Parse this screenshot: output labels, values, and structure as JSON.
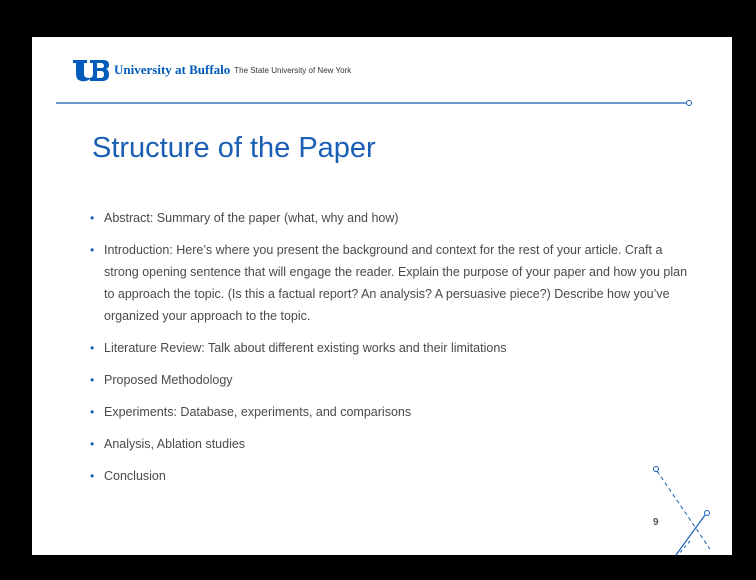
{
  "header": {
    "university_name": "University at Buffalo",
    "subtitle": "The State University of New York"
  },
  "slide": {
    "title": "Structure of the Paper",
    "bullets": [
      "Abstract: Summary of the paper (what, why and how)",
      "Introduction: Here’s where you present the background and context for the rest of your article. Craft a strong opening sentence that will engage the reader. Explain the purpose of your paper and how you plan to approach the topic. (Is this a factual report? An analysis? A persuasive piece?) Describe how you’ve organized your approach to the topic.",
      "Literature Review: Talk about different existing works and their limitations",
      "Proposed Methodology",
      "Experiments: Database, experiments, and comparisons",
      "Analysis, Ablation studies",
      "Conclusion"
    ],
    "page_number": "9"
  },
  "colors": {
    "brand_blue": "#005bbb",
    "title_blue": "#1a5fb4",
    "body_text": "#4a4a4a",
    "background": "#000000"
  }
}
